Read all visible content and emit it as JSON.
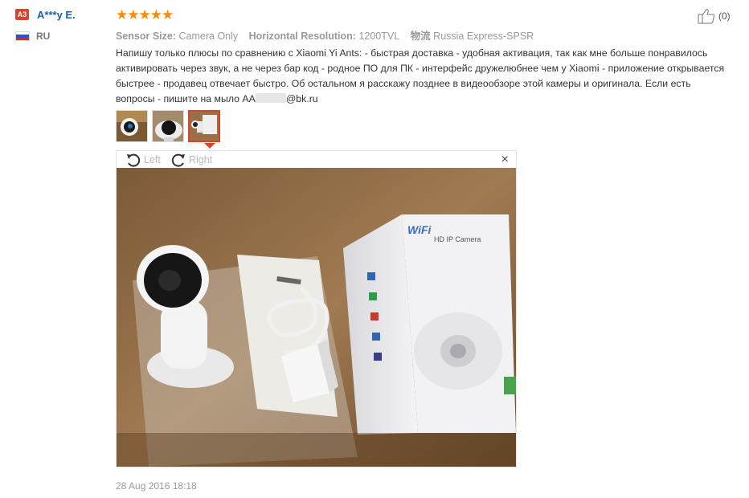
{
  "reviewer": {
    "level_badge": "A3",
    "name": "A***y E.",
    "country_code": "RU",
    "flag_colors": [
      "#ffffff",
      "#2a55c8",
      "#d52b1e"
    ]
  },
  "rating": {
    "stars": 5,
    "star_color": "#fe8c00"
  },
  "helpful": {
    "count_label": "(0)"
  },
  "properties": [
    {
      "name": "Sensor Size:",
      "value": "Camera Only"
    },
    {
      "name": "Horizontal Resolution:",
      "value": "1200TVL"
    },
    {
      "name": "物流",
      "value": "Russia Express-SPSR"
    }
  ],
  "feedback": {
    "text_before_mask": "Напишу только плюсы по сравнению с Xiaomi Yi Ants: - быстрая доставка - удобная активация, так как мне больше понравилось активировать через звук, а не через бар код - родное ПО для ПК - интерфейс дружелюбнее чем у Xiaomi - приложение открывается быстрее - продавец отвечает быстро. Об остальном я расскажу позднее в видеообзоре этой камеры и оригинала. Если есть вопросы - пишите на мыло AA",
    "text_after_mask": "@bk.ru"
  },
  "photos": {
    "thumb_names": [
      "thumbnail-1",
      "thumbnail-2",
      "thumbnail-3"
    ],
    "selected_index": 2
  },
  "viewer": {
    "rotate_left_label": "Left",
    "rotate_right_label": "Right",
    "close_symbol": "×",
    "box_label": "WiFi",
    "box_sublabel": "HD IP Camera"
  },
  "date": "28 Aug 2016 18:18",
  "accent_colors": {
    "link_blue": "#1c5eab",
    "badge_red": "#d8452c"
  }
}
